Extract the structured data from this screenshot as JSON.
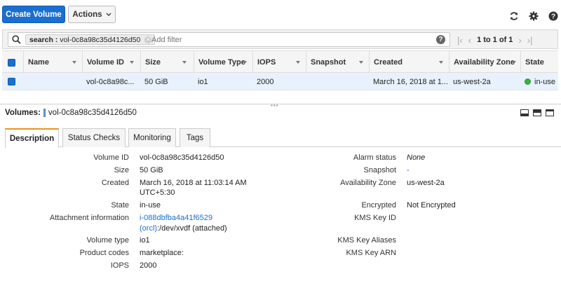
{
  "toolbar": {
    "create_label": "Create Volume",
    "actions_label": "Actions"
  },
  "filter": {
    "chip_key": "search :",
    "chip_value": "vol-0c8a98c35d4126d50",
    "placeholder": "Add filter",
    "pager_text": "1 to 1 of 1"
  },
  "table": {
    "headers": [
      "Name",
      "Volume ID",
      "Size",
      "Volume Type",
      "IOPS",
      "Snapshot",
      "Created",
      "Availability Zone",
      "State"
    ],
    "row": {
      "name": "",
      "volume_id": "vol-0c8a98c...",
      "size": "50 GiB",
      "volume_type": "io1",
      "iops": "2000",
      "snapshot": "",
      "created": "March 16, 2018 at 1...",
      "zone": "us-west-2a",
      "state": "in-use"
    }
  },
  "detail": {
    "title_label": "Volumes:",
    "title_value": "vol-0c8a98c35d4126d50",
    "tabs": [
      "Description",
      "Status Checks",
      "Monitoring",
      "Tags"
    ],
    "left": {
      "volume_id_k": "Volume ID",
      "volume_id_v": "vol-0c8a98c35d4126d50",
      "size_k": "Size",
      "size_v": "50 GiB",
      "created_k": "Created",
      "created_v1": "March 16, 2018 at 11:03:14 AM",
      "created_v2": "UTC+5:30",
      "state_k": "State",
      "state_v": "in-use",
      "attach_k": "Attachment information",
      "attach_link": "i-088dbfba4a41f6529",
      "attach_orcl": "(orcl)",
      "attach_rest": ":/dev/xvdf (attached)",
      "type_k": "Volume type",
      "type_v": "io1",
      "codes_k": "Product codes",
      "codes_v": "marketplace:",
      "iops_k": "IOPS",
      "iops_v": "2000"
    },
    "right": {
      "alarm_k": "Alarm status",
      "alarm_v": "None",
      "snap_k": "Snapshot",
      "snap_v": "-",
      "az_k": "Availability Zone",
      "az_v": "us-west-2a",
      "enc_k": "Encrypted",
      "enc_v": "Not Encrypted",
      "kms_k": "KMS Key ID",
      "alias_k": "KMS Key Aliases",
      "arn_k": "KMS Key ARN"
    }
  }
}
